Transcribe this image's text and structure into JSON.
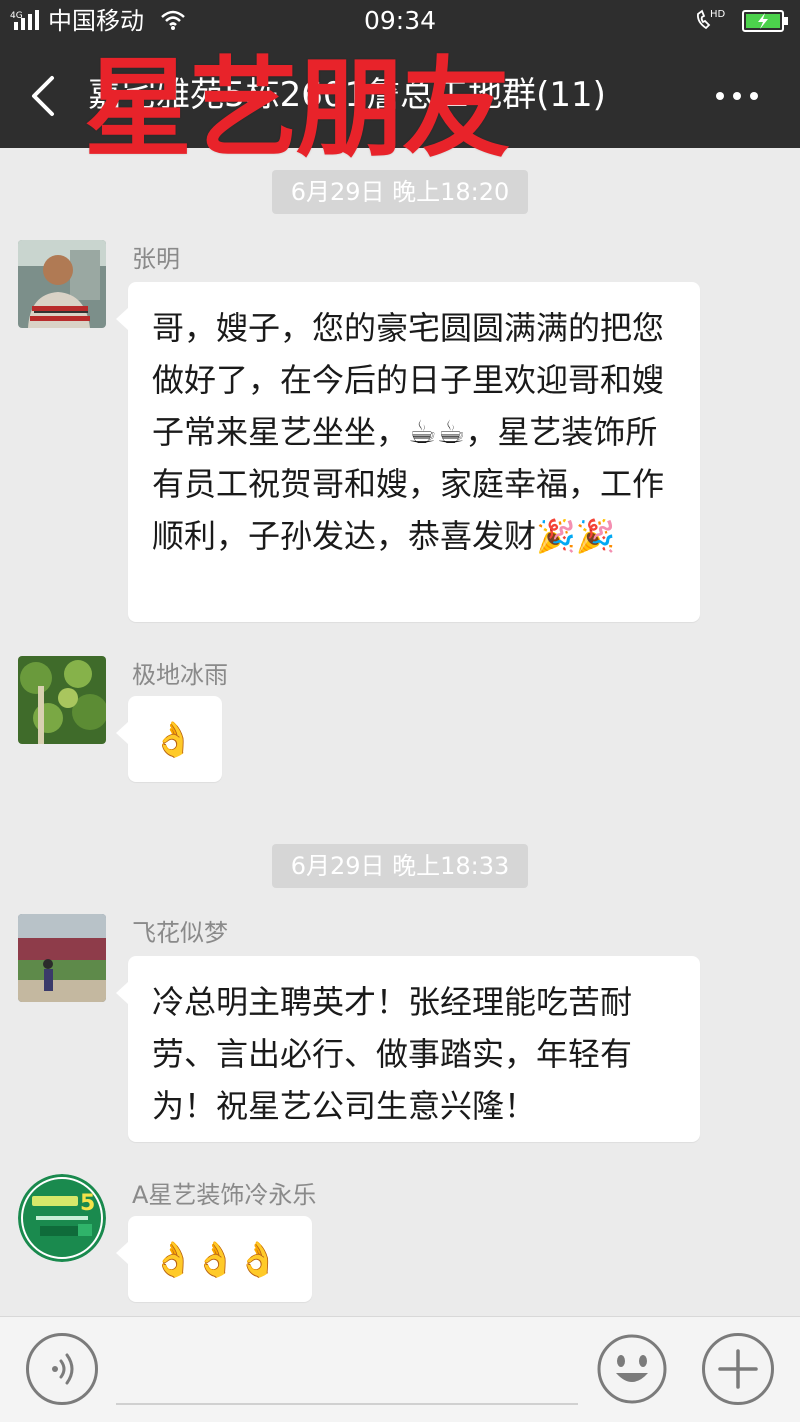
{
  "status_bar": {
    "network_type": "4G",
    "carrier": "中国移动",
    "time": "09:34",
    "call_badge": "HD"
  },
  "header": {
    "title": "嘉宅雅苑5栋2601詹总工地群(11)",
    "watermark": "星艺朋友"
  },
  "messages": [
    {
      "kind": "timestamp",
      "text": "6月29日 晚上18:20"
    },
    {
      "kind": "message",
      "sender": "张明",
      "text": "哥，嫂子，您的豪宅圆圆满满的把您做好了，在今后的日子里欢迎哥和嫂子常来星艺坐坐，☕☕，星艺装饰所有员工祝贺哥和嫂，家庭幸福，工作顺利，子孙发达，恭喜发财🎉🎉"
    },
    {
      "kind": "message",
      "sender": "极地冰雨",
      "text": "👌"
    },
    {
      "kind": "timestamp",
      "text": "6月29日 晚上18:33"
    },
    {
      "kind": "message",
      "sender": "飞花似梦",
      "text": "冷总明主聘英才！张经理能吃苦耐劳、言出必行、做事踏实，年轻有为！祝星艺公司生意兴隆！"
    },
    {
      "kind": "message",
      "sender": "A星艺装饰冷永乐",
      "text": "👌👌👌"
    }
  ],
  "avatar_badge_text": "5",
  "colors": {
    "title_bar": "#2e2e2e",
    "chat_background": "#ebebeb",
    "bubble": "#ffffff",
    "watermark": "#e8232a",
    "timestamp_pill": "#d6d6d6"
  },
  "icons": [
    "signal-icon",
    "wifi-icon",
    "hd-call-icon",
    "battery-charging-icon",
    "back-arrow-icon",
    "more-icon",
    "voice-icon",
    "emoji-icon",
    "plus-icon"
  ]
}
